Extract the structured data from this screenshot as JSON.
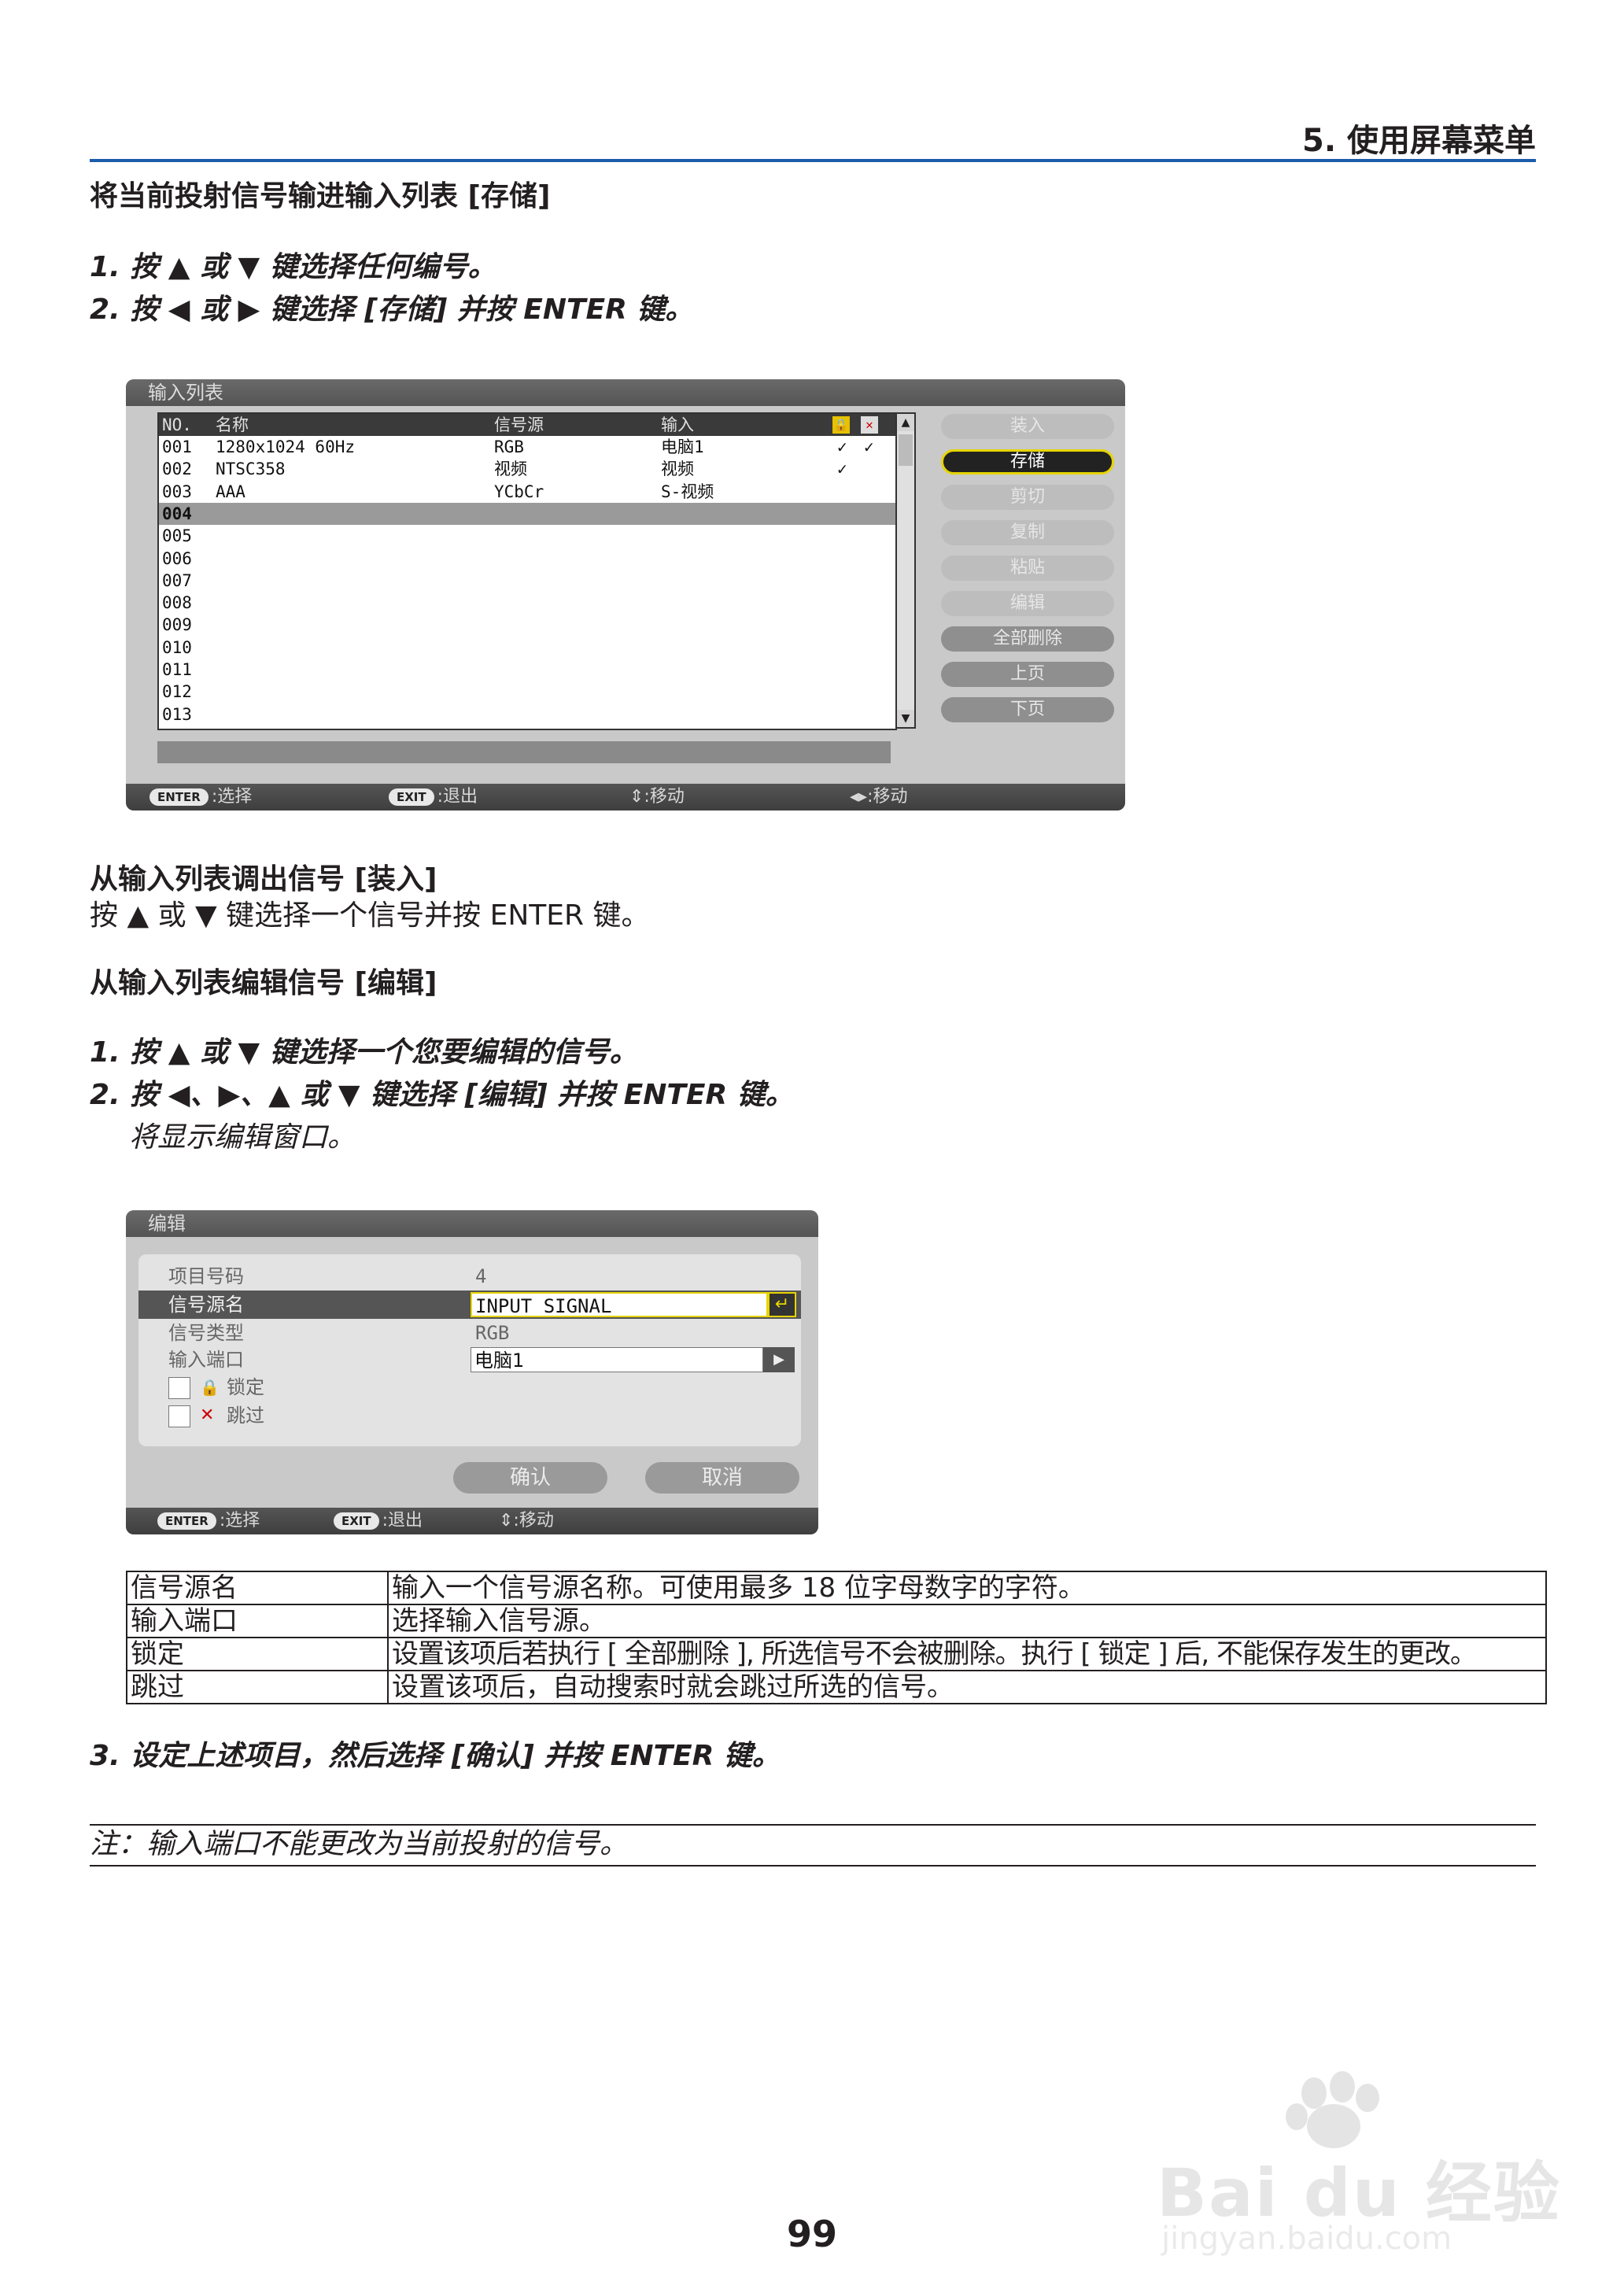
{
  "header": {
    "section_title": "5. 使用屏幕菜单"
  },
  "section1": {
    "heading": "将当前投射信号输进输入列表 [存储]",
    "step1": "1.  按 ▲ 或 ▼ 键选择任何编号。",
    "step2": "2.  按 ◀ 或 ▶ 键选择 [存储] 并按 ENTER 键。"
  },
  "input_list_panel": {
    "title": "输入列表",
    "columns": {
      "no": "NO.",
      "name": "名称",
      "source": "信号源",
      "input": "输入"
    },
    "rows": [
      {
        "no": "001",
        "name": "1280x1024 60Hz",
        "source": "RGB",
        "input": "电脑1",
        "lock": "✓",
        "skip": "✓"
      },
      {
        "no": "002",
        "name": "NTSC358",
        "source": "视频",
        "input": "视频",
        "lock": "✓",
        "skip": ""
      },
      {
        "no": "003",
        "name": "AAA",
        "source": "YCbCr",
        "input": "S-视频",
        "lock": "",
        "skip": ""
      },
      {
        "no": "004",
        "name": "",
        "source": "",
        "input": "",
        "lock": "",
        "skip": ""
      },
      {
        "no": "005",
        "name": "",
        "source": "",
        "input": "",
        "lock": "",
        "skip": ""
      },
      {
        "no": "006",
        "name": "",
        "source": "",
        "input": "",
        "lock": "",
        "skip": ""
      },
      {
        "no": "007",
        "name": "",
        "source": "",
        "input": "",
        "lock": "",
        "skip": ""
      },
      {
        "no": "008",
        "name": "",
        "source": "",
        "input": "",
        "lock": "",
        "skip": ""
      },
      {
        "no": "009",
        "name": "",
        "source": "",
        "input": "",
        "lock": "",
        "skip": ""
      },
      {
        "no": "010",
        "name": "",
        "source": "",
        "input": "",
        "lock": "",
        "skip": ""
      },
      {
        "no": "011",
        "name": "",
        "source": "",
        "input": "",
        "lock": "",
        "skip": ""
      },
      {
        "no": "012",
        "name": "",
        "source": "",
        "input": "",
        "lock": "",
        "skip": ""
      },
      {
        "no": "013",
        "name": "",
        "source": "",
        "input": "",
        "lock": "",
        "skip": ""
      }
    ],
    "selected_row": "004",
    "buttons": {
      "load": "装入",
      "store": "存储",
      "cut": "剪切",
      "copy": "复制",
      "paste": "粘贴",
      "edit": "编辑",
      "all_delete": "全部删除",
      "page_up": "上页",
      "page_down": "下页"
    },
    "footer": {
      "enter_key": "ENTER",
      "enter_text": ":选择",
      "exit_key": "EXIT",
      "exit_text": ":退出",
      "updown_text": "⇕:移动",
      "leftright_text": "◂▸:移动"
    }
  },
  "section2": {
    "heading": "从输入列表调出信号 [装入]",
    "body": "按 ▲ 或 ▼ 键选择一个信号并按 ENTER 键。"
  },
  "section3": {
    "heading": "从输入列表编辑信号 [编辑]",
    "step1": "1.  按 ▲ 或 ▼ 键选择一个您要编辑的信号。",
    "step2": "2.  按 ◀、▶、▲ 或 ▼ 键选择 [编辑] 并按 ENTER 键。",
    "step2_note": "将显示编辑窗口。"
  },
  "edit_panel": {
    "title": "编辑",
    "item_no_label": "项目号码",
    "item_no_value": "4",
    "source_name_label": "信号源名",
    "source_name_value": "INPUT SIGNAL",
    "signal_type_label": "信号类型",
    "signal_type_value": "RGB",
    "input_port_label": "输入端口",
    "input_port_value": "电脑1",
    "lock_label": "锁定",
    "skip_label": "跳过",
    "ok_label": "确认",
    "cancel_label": "取消",
    "footer": {
      "enter_key": "ENTER",
      "enter_text": ":选择",
      "exit_key": "EXIT",
      "exit_text": ":退出",
      "updown_text": "⇕:移动"
    }
  },
  "desc_table": [
    {
      "term": "信号源名",
      "desc": "输入一个信号源名称。可使用最多 18 位字母数字的字符。"
    },
    {
      "term": "输入端口",
      "desc": "选择输入信号源。"
    },
    {
      "term": "锁定",
      "desc": "设置该项后若执行 [ 全部删除 ], 所选信号不会被删除。执行 [ 锁定 ] 后, 不能保存发生的更改。"
    },
    {
      "term": "跳过",
      "desc": "设置该项后，自动搜索时就会跳过所选的信号。"
    }
  ],
  "step3": "3.  设定上述项目，然后选择 [确认] 并按 ENTER 键。",
  "note": "注：输入端口不能更改为当前投射的信号。",
  "page_number": "99",
  "watermark": {
    "brand": "Bai du 经验",
    "url": "jingyan.baidu.com"
  }
}
